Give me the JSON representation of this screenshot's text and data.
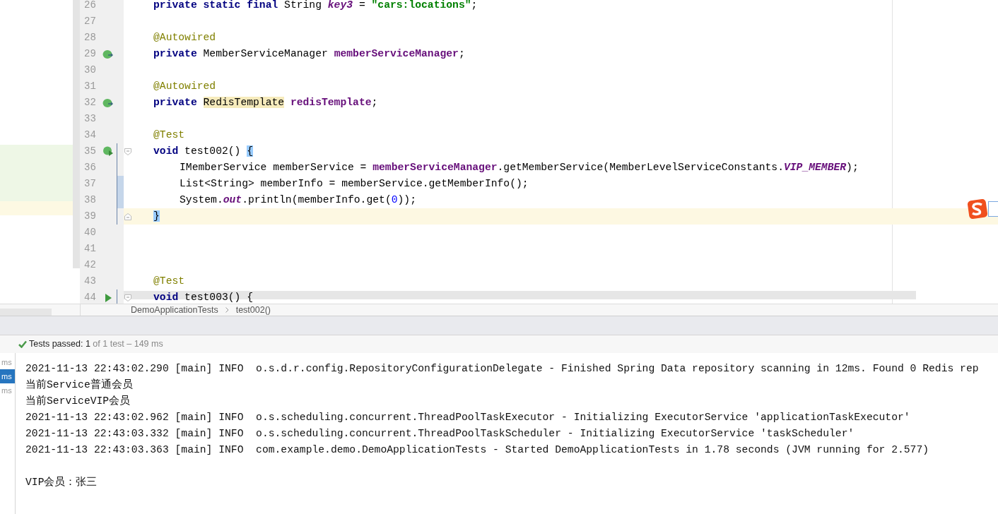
{
  "editor": {
    "lines": [
      {
        "number": "26",
        "tokens": [
          {
            "kind": "kw",
            "text": "private static final"
          },
          {
            "kind": "plain",
            "text": " String "
          },
          {
            "kind": "static",
            "text": "key3"
          },
          {
            "kind": "plain",
            "text": " = "
          },
          {
            "kind": "str",
            "text": "\"cars:locations\""
          },
          {
            "kind": "plain",
            "text": ";"
          }
        ]
      },
      {
        "number": "27"
      },
      {
        "number": "28",
        "tokens": [
          {
            "kind": "ann",
            "text": "@Autowired"
          }
        ]
      },
      {
        "number": "29",
        "kind": "bean",
        "tokens": [
          {
            "kind": "kw",
            "text": "private"
          },
          {
            "kind": "plain",
            "text": " MemberServiceManager "
          },
          {
            "kind": "field",
            "text": "memberServiceManager"
          },
          {
            "kind": "plain",
            "text": ";"
          }
        ]
      },
      {
        "number": "30"
      },
      {
        "number": "31",
        "tokens": [
          {
            "kind": "ann",
            "text": "@Autowired"
          }
        ]
      },
      {
        "number": "32",
        "kind": "bean",
        "tokens": [
          {
            "kind": "kw",
            "text": "private "
          },
          {
            "kind": "type-hl",
            "text": "RedisTemplate"
          },
          {
            "kind": "field",
            "text": " redisTemplate"
          },
          {
            "kind": "plain",
            "text": ";"
          }
        ]
      },
      {
        "number": "33"
      },
      {
        "number": "34",
        "tokens": [
          {
            "kind": "ann",
            "text": "@Test"
          }
        ]
      },
      {
        "number": "35",
        "kind": "run-bean",
        "fold_start": true,
        "tokens": [
          {
            "kind": "kw",
            "text": "void"
          },
          {
            "kind": "plain",
            "text": " test002() "
          },
          {
            "kind": "brace-hl",
            "text": "{"
          }
        ]
      },
      {
        "number": "36",
        "body": true,
        "tokens": [
          {
            "kind": "plain",
            "text": "IMemberService memberService = "
          },
          {
            "kind": "field",
            "text": "memberServiceManager"
          },
          {
            "kind": "plain",
            "text": ".getMemberService(MemberLevelServiceConstants."
          },
          {
            "kind": "static",
            "text": "VIP_MEMBER"
          },
          {
            "kind": "plain",
            "text": ");"
          }
        ]
      },
      {
        "number": "37",
        "body": true,
        "changed": true,
        "tokens": [
          {
            "kind": "plain",
            "text": "List<String> memberInfo = memberService.getMemberInfo();"
          }
        ]
      },
      {
        "number": "38",
        "body": true,
        "changed": true,
        "tokens": [
          {
            "kind": "plain",
            "text": "System."
          },
          {
            "kind": "static",
            "text": "out"
          },
          {
            "kind": "plain",
            "text": ".println(memberInfo.get("
          },
          {
            "kind": "num",
            "text": "0"
          },
          {
            "kind": "plain",
            "text": "));"
          }
        ]
      },
      {
        "number": "39",
        "current": true,
        "fold_end": true,
        "tokens": [
          {
            "kind": "brace-hl",
            "text": "}"
          }
        ]
      },
      {
        "number": "40"
      },
      {
        "number": "41"
      },
      {
        "number": "42"
      },
      {
        "number": "43",
        "tokens": [
          {
            "kind": "ann",
            "text": "@Test"
          }
        ]
      },
      {
        "number": "44",
        "kind": "run",
        "fold_start": true,
        "tokens": [
          {
            "kind": "kw",
            "text": "void"
          },
          {
            "kind": "plain",
            "text": " test003() {"
          }
        ]
      }
    ]
  },
  "breadcrumbs": [
    "DemoApplicationTests",
    "test002()"
  ],
  "test_status": {
    "label": "Tests passed:",
    "count": "1",
    "detail": "of 1 test – 149 ms"
  },
  "run_list": [
    {
      "text": "ms",
      "selected": false
    },
    {
      "text": "ms",
      "selected": true
    },
    {
      "text": "ms",
      "selected": false
    }
  ],
  "console": {
    "lines": [
      "2021-11-13 22:43:02.290 [main] INFO  o.s.d.r.config.RepositoryConfigurationDelegate - Finished Spring Data repository scanning in 12ms. Found 0 Redis rep",
      "当前Service普通会员",
      "当前ServiceVIP会员",
      "2021-11-13 22:43:02.962 [main] INFO  o.s.scheduling.concurrent.ThreadPoolTaskExecutor - Initializing ExecutorService 'applicationTaskExecutor'",
      "2021-11-13 22:43:03.332 [main] INFO  o.s.scheduling.concurrent.ThreadPoolTaskScheduler - Initializing ExecutorService 'taskScheduler'",
      "2021-11-13 22:43:03.363 [main] INFO  com.example.demo.DemoApplicationTests - Started DemoApplicationTests in 1.78 seconds (JVM running for 2.577)"
    ],
    "result": "VIP会员：张三"
  }
}
